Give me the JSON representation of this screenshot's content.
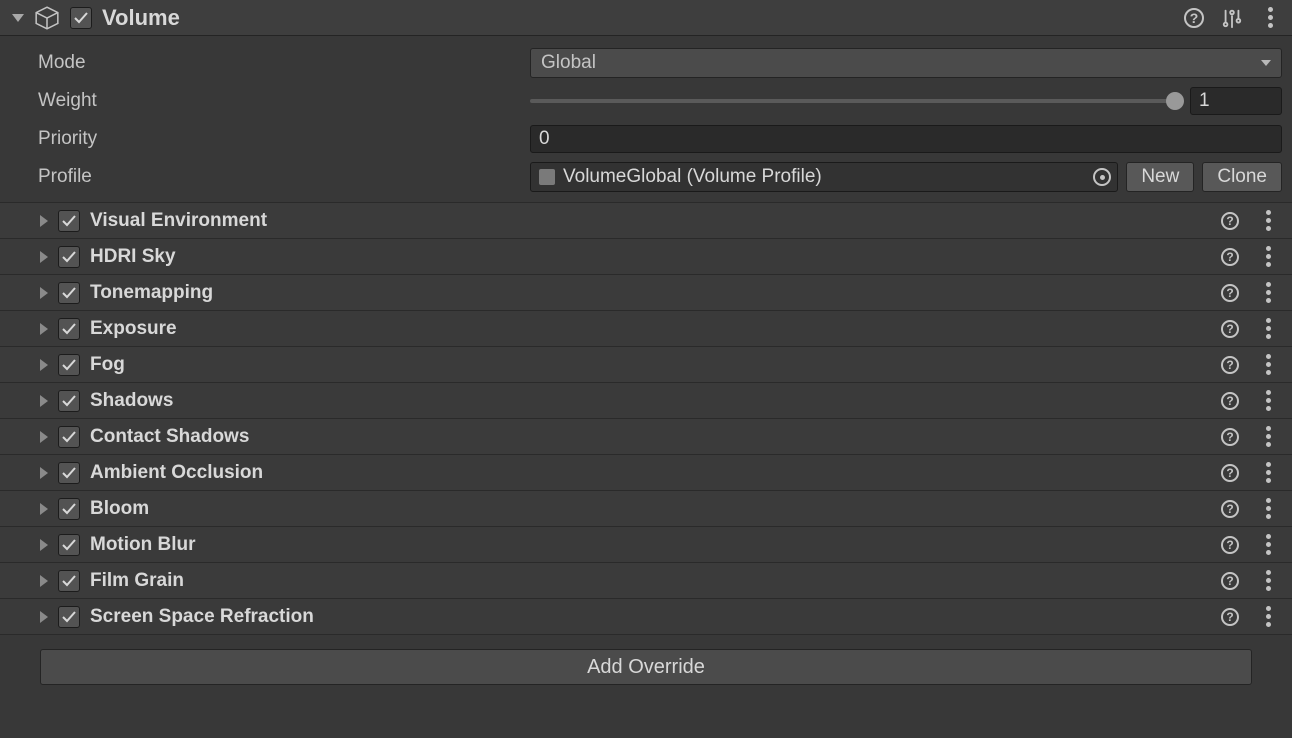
{
  "header": {
    "title": "Volume",
    "enabled": true
  },
  "props": {
    "mode_label": "Mode",
    "mode_value": "Global",
    "weight_label": "Weight",
    "weight_value": "1",
    "priority_label": "Priority",
    "priority_value": "0",
    "profile_label": "Profile",
    "profile_value": "VolumeGlobal (Volume Profile)",
    "new_btn": "New",
    "clone_btn": "Clone"
  },
  "overrides": [
    {
      "label": "Visual Environment",
      "enabled": true
    },
    {
      "label": "HDRI Sky",
      "enabled": true
    },
    {
      "label": "Tonemapping",
      "enabled": true
    },
    {
      "label": "Exposure",
      "enabled": true
    },
    {
      "label": "Fog",
      "enabled": true
    },
    {
      "label": "Shadows",
      "enabled": true
    },
    {
      "label": "Contact Shadows",
      "enabled": true
    },
    {
      "label": "Ambient Occlusion",
      "enabled": true
    },
    {
      "label": "Bloom",
      "enabled": true
    },
    {
      "label": "Motion Blur",
      "enabled": true
    },
    {
      "label": "Film Grain",
      "enabled": true
    },
    {
      "label": "Screen Space Refraction",
      "enabled": true
    }
  ],
  "add_override_label": "Add Override"
}
